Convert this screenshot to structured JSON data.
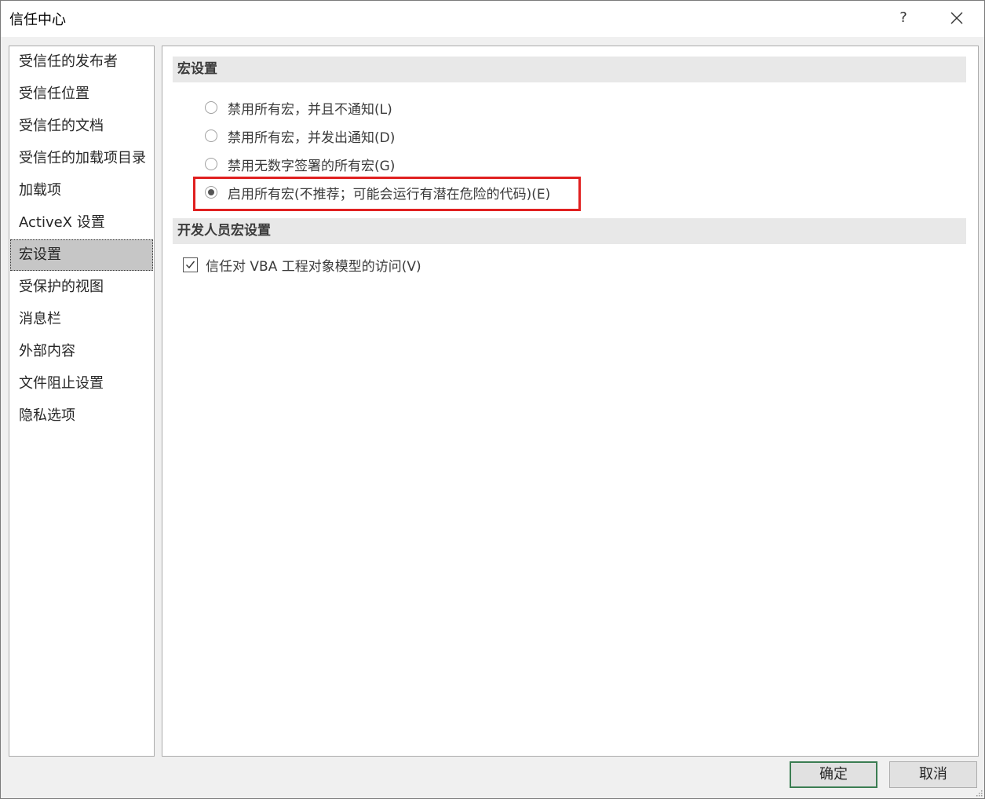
{
  "window": {
    "title": "信任中心",
    "help_label": "?"
  },
  "sidebar": {
    "items": [
      {
        "label": "受信任的发布者"
      },
      {
        "label": "受信任位置"
      },
      {
        "label": "受信任的文档"
      },
      {
        "label": "受信任的加载项目录"
      },
      {
        "label": "加载项"
      },
      {
        "label": "ActiveX 设置"
      },
      {
        "label": "宏设置",
        "selected": true
      },
      {
        "label": "受保护的视图"
      },
      {
        "label": "消息栏"
      },
      {
        "label": "外部内容"
      },
      {
        "label": "文件阻止设置"
      },
      {
        "label": "隐私选项"
      }
    ]
  },
  "macro_settings": {
    "header": "宏设置",
    "options": [
      {
        "label": "禁用所有宏，并且不通知(L)",
        "checked": false
      },
      {
        "label": "禁用所有宏，并发出通知(D)",
        "checked": false
      },
      {
        "label": "禁用无数字签署的所有宏(G)",
        "checked": false
      },
      {
        "label": "启用所有宏(不推荐；可能会运行有潜在危险的代码)(E)",
        "checked": true
      }
    ],
    "highlight_color": "#e02020"
  },
  "developer_settings": {
    "header": "开发人员宏设置",
    "vba_access_label": "信任对 VBA 工程对象模型的访问(V)",
    "vba_access_checked": true
  },
  "footer": {
    "ok_label": "确定",
    "cancel_label": "取消"
  }
}
